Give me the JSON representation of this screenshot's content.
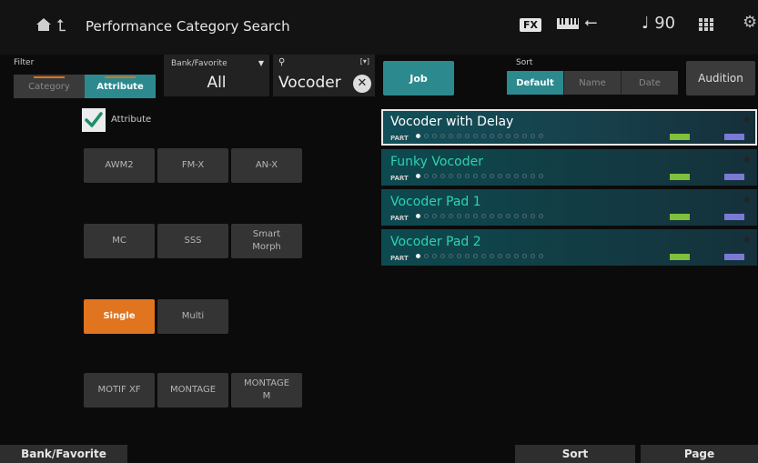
{
  "header": {
    "title": "Performance Category Search",
    "fx_label": "FX",
    "tempo": "♩ 90",
    "icons": [
      "home-icon",
      "back-icon",
      "keyboard-icon",
      "usb-icon",
      "grid-icon",
      "gear-icon"
    ]
  },
  "filter": {
    "label": "Filter",
    "tabs": [
      "Category",
      "Attribute"
    ],
    "active": "Attribute"
  },
  "bank": {
    "label": "Bank/Favorite",
    "value": "All"
  },
  "search": {
    "value": "Vocoder"
  },
  "job_label": "Job",
  "sort": {
    "label": "Sort",
    "options": [
      "Default",
      "Name",
      "Date"
    ],
    "active": "Default"
  },
  "audition_label": "Audition",
  "attribute": {
    "checkbox_label": "Attribute",
    "checked": true,
    "buttons": [
      {
        "label": "AWM2",
        "on": false
      },
      {
        "label": "FM-X",
        "on": false
      },
      {
        "label": "AN-X",
        "on": false
      },
      {
        "label": "MC",
        "on": false
      },
      {
        "label": "SSS",
        "on": false
      },
      {
        "label": "Smart\nMorph",
        "on": false
      },
      {
        "label": "Single",
        "on": true
      },
      {
        "label": "Multi",
        "on": false
      },
      {
        "label": "MOTIF XF",
        "on": false
      },
      {
        "label": "MONTAGE",
        "on": false
      },
      {
        "label": "MONTAGE\nM",
        "on": false
      }
    ]
  },
  "results": [
    {
      "name": "Vocoder with Delay",
      "part_label": "PART",
      "selected": true
    },
    {
      "name": "Funky Vocoder",
      "part_label": "PART",
      "selected": false
    },
    {
      "name": "Vocoder Pad 1",
      "part_label": "PART",
      "selected": false
    },
    {
      "name": "Vocoder Pad 2",
      "part_label": "PART",
      "selected": false
    }
  ],
  "footer": {
    "bank_favorite": "Bank/Favorite",
    "sort": "Sort",
    "page": "Page"
  },
  "colors": {
    "accent_teal": "#2c8a8f",
    "accent_orange": "#e0741f",
    "result_text": "#2dd3b0"
  }
}
